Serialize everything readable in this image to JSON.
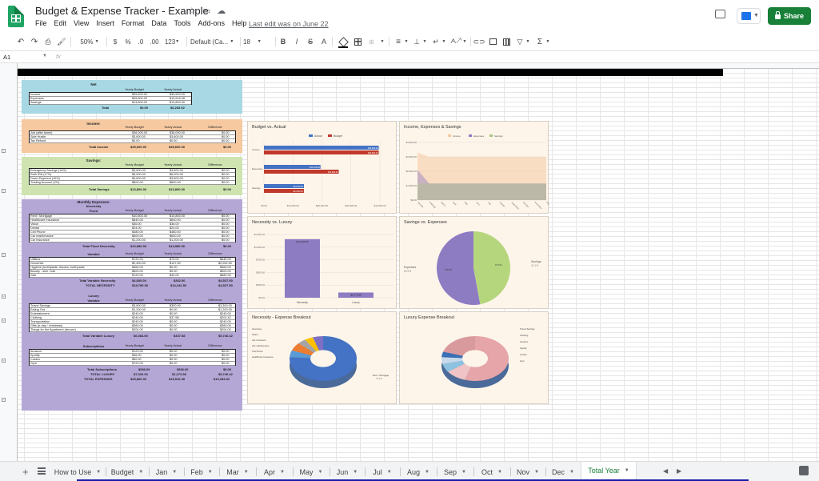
{
  "window": {
    "doc_title": "Budget & Expense Tracker - Example",
    "last_edit": "Last edit was on June 22"
  },
  "menu": [
    "File",
    "Edit",
    "View",
    "Insert",
    "Format",
    "Data",
    "Tools",
    "Add-ons",
    "Help"
  ],
  "share_label": "Share",
  "toolbar": {
    "zoom": "50%",
    "currency": "$",
    "percent": "%",
    "dec_less": ".0",
    "dec_more": ".00",
    "number_format": "123",
    "font": "Default (Ca...",
    "font_size": "18",
    "bold": "B",
    "italic": "I",
    "strike": "S",
    "text_color": "A",
    "sigma": "Σ"
  },
  "formula_bar": {
    "cell_ref": "A1",
    "fx": "fx"
  },
  "tables": {
    "net": {
      "title": "Net",
      "headers": [
        "Yearly Budget",
        "Yearly Actual"
      ],
      "rows": [
        [
          "Income",
          "$39,600.00",
          "$39,600.00"
        ],
        [
          "Expenses",
          "$25,800.00",
          "$19,516.08"
        ],
        [
          "Savings",
          "$13,800.00",
          "$13,800.00"
        ]
      ],
      "total": [
        "Total",
        "$0.00",
        "$6,283.92"
      ]
    },
    "income": {
      "title": "Income:",
      "headers": [
        "Yearly Budget",
        "Yearly Actual",
        "Difference"
      ],
      "rows": [
        [
          "Job (after taxes)",
          "$36,000.00",
          "$36,000.00",
          "$0.00"
        ],
        [
          "Side Hustle",
          "$3,600.00",
          "$3,600.00",
          "$0.00"
        ],
        [
          "Tax Refund",
          "$0.00",
          "$0.00",
          "$0.00"
        ]
      ],
      "total": [
        "Total Income",
        "$39,600.00",
        "$39,600.00",
        "$0.00"
      ]
    },
    "savings": {
      "title": "Savings:",
      "headers": [
        "Yearly Budget",
        "Yearly Actual",
        "Difference"
      ],
      "rows": [
        [
          "Emergency Savings (10%)",
          "$3,600.00",
          "$3,600.00",
          "$0.00"
        ],
        [
          "Roth IRA (17%)",
          "$6,000.00",
          "$6,000.00",
          "$0.00"
        ],
        [
          "Down Payment (10%)",
          "$3,600.00",
          "$3,600.00",
          "$0.00"
        ],
        [
          "Trading Account (2%)",
          "$600.00",
          "$600.00",
          "$0.00"
        ]
      ],
      "total": [
        "Total Savings",
        "$13,800.00",
        "$13,800.00",
        "$0.00"
      ]
    },
    "expenses_title": "Monthly Expenses:",
    "necessity_title": "Necessity",
    "fixed": {
      "title": "Fixed",
      "headers": [
        "Yearly Budget",
        "Yearly Actual",
        "Difference"
      ],
      "rows": [
        [
          "Rent / Mortgage",
          "$10,800.00",
          "$10,800.00",
          "$0.00"
        ],
        [
          "Healthcare Insurance",
          "$840.00",
          "$840.00",
          "$0.00"
        ],
        [
          "Vision",
          "$36.00",
          "$36.00",
          "$0.00"
        ],
        [
          "Dental",
          "$24.00",
          "$24.00",
          "$0.00"
        ],
        [
          "Cell Phone",
          "$480.00",
          "$480.00",
          "$0.00"
        ],
        [
          "Car maintenance",
          "$600.00",
          "$600.00",
          "$0.00"
        ],
        [
          "Car Insurance",
          "$1,200.00",
          "$1,200.00",
          "$0.00"
        ]
      ],
      "total": [
        "Total Fixed Necessity",
        "$13,980.00",
        "$13,980.00",
        "$0.00"
      ]
    },
    "variable": {
      "title": "Variable",
      "headers": [
        "Yearly Budget",
        "Yearly Actual",
        "Difference"
      ],
      "rows": [
        [
          "Utilities",
          "$720.00",
          "$75.00",
          "$645.00"
        ],
        [
          "Groceries",
          "$2,400.00",
          "$147.50",
          "$2,252.50"
        ],
        [
          "Hygiene (toothpaste, tissues, toothpaste",
          "$360.00",
          "$0.00",
          "$360.00"
        ],
        [
          "Beauty - skin / hair",
          "$600.00",
          "$0.00",
          "$600.00"
        ],
        [
          "Gas",
          "$720.00",
          "$40.00",
          "$680.00"
        ]
      ],
      "total": [
        "Total Variable Necessity",
        "$4,800.00",
        "$262.50",
        "$4,537.50"
      ],
      "grand": [
        "TOTAL NECESSITY",
        "$18,780.00",
        "$14,242.50",
        "$4,537.50"
      ]
    },
    "luxury_title": "Luxury",
    "lux_variable": {
      "title": "Variable",
      "headers": [
        "Yearly Budget",
        "Yearly Actual",
        "Difference"
      ],
      "rows": [
        [
          "Travel Savings",
          "$3,600.00",
          "$300.00",
          "$3,300.00"
        ],
        [
          "Eating Out",
          "$1,200.00",
          "$0.00",
          "$1,200.00"
        ],
        [
          "Entertainment",
          "$240.00",
          "$0.00",
          "$240.00"
        ],
        [
          "Clothing",
          "$240.00",
          "$37.58",
          "$202.42"
        ],
        [
          "Transportation",
          "$240.00",
          "$0.00",
          "$240.00"
        ],
        [
          "Gifts (b-day / christmas)",
          "$360.00",
          "$0.00",
          "$360.00"
        ],
        [
          "Things for the Apartment (decore)",
          "$204.00",
          "$0.00",
          "$204.00"
        ]
      ],
      "total": [
        "Total Variable Luxury",
        "$6,084.00",
        "$337.58",
        "$5,746.42"
      ]
    },
    "subscriptions": {
      "title": "Subscriptions",
      "headers": [
        "Yearly Budget",
        "Yearly Actual",
        "Difference"
      ],
      "rows": [
        [
          "Amazon",
          "$120.00",
          "$0.00",
          "$0.00"
        ],
        [
          "Spotify",
          "$36.00",
          "$0.00",
          "$0.00"
        ],
        [
          "Costco",
          "$60.00",
          "$0.00",
          "$0.00"
        ],
        [
          "Gym",
          "$720.00",
          "$0.00",
          "$0.00"
        ]
      ],
      "total": [
        "Total Subscriptions",
        "$936.00",
        "$936.00",
        "$0.00"
      ],
      "lux_total": [
        "TOTAL LUXURY",
        "$7,020.00",
        "$1,273.58",
        "$5,746.42"
      ],
      "exp_total": [
        "TOTAL EXPENSES",
        "$25,800.00",
        "$15,516.08",
        "$10,283.92"
      ]
    }
  },
  "charts": {
    "budget_vs_actual": {
      "title": "Budget vs. Actual",
      "legend": [
        "Actual",
        "Budget"
      ],
      "categories": [
        "Income",
        "Expenses",
        "Savings"
      ],
      "actual_values": [
        39600,
        19516.08,
        13800
      ],
      "budget_values": [
        39600,
        25800,
        13800
      ],
      "actual_labels": [
        "$39,600.00",
        "$19,516.08",
        "$13,800.00"
      ],
      "budget_labels": [
        "$39,600.00",
        "$25,800.00",
        "$13,800.00"
      ],
      "x_ticks": [
        "$0.00",
        "$10,000.00",
        "$20,000.00",
        "$30,000.00",
        "$40,000.00"
      ],
      "colors": {
        "actual": "#4472c4",
        "budget": "#c0392b"
      }
    },
    "income_exp_sav": {
      "title": "Income, Expenses & Savings",
      "legend": [
        "Income",
        "Expenses",
        "Savings"
      ],
      "y_ticks": [
        "$0.00",
        "$1,000.00",
        "$2,000.00",
        "$3,000.00",
        "$4,000.00"
      ],
      "x_ticks": [
        "January",
        "February",
        "March",
        "April",
        "May",
        "June",
        "July",
        "August",
        "September",
        "October",
        "November",
        "December"
      ],
      "colors": {
        "income": "#f6c9a0",
        "expenses": "#8e7cc3",
        "savings": "#a9c47f"
      }
    },
    "necessity_vs_luxury": {
      "title": "Necessity vs. Luxury",
      "categories": [
        "Necessity",
        "Luxury"
      ],
      "values": [
        14242.5,
        1273.58
      ],
      "labels": [
        "$14,242.50",
        "$1,273.58"
      ],
      "y_ticks": [
        "$0.00",
        "$250.00",
        "$500.00",
        "$750.00",
        "$1,000.00",
        "$1,250.00"
      ],
      "color": "#8e7cc3"
    },
    "savings_vs_expenses": {
      "title": "Savings vs. Expenses",
      "slices": [
        {
          "name": "Savings",
          "pct": "47.1%",
          "value": 47.1,
          "color": "#b6d67e"
        },
        {
          "name": "Expenses",
          "pct": "52.9%",
          "value": 52.9,
          "color": "#8e7cc3"
        }
      ]
    },
    "necessity_breakout": {
      "title": "Necessity - Expense Breakout",
      "labels": [
        "Groceries",
        "Vision",
        "Car Insurance",
        "Car maintenance",
        "Cell Phone",
        "Healthcare Insurance"
      ],
      "main_label": "Rent / Mortgage",
      "main_pct": "75.8%"
    },
    "luxury_breakout": {
      "title": "Luxury Expense Breakout",
      "labels": [
        "Travel Savings",
        "Clothing",
        "Amazon",
        "Spotify",
        "Costco",
        "Gym"
      ]
    }
  },
  "sheet_tabs": [
    "How to Use",
    "Budget",
    "Jan",
    "Feb",
    "Mar",
    "Apr",
    "May",
    "Jun",
    "Jul",
    "Aug",
    "Sep",
    "Oct",
    "Nov",
    "Dec",
    "Total Year"
  ],
  "active_tab": "Total Year"
}
